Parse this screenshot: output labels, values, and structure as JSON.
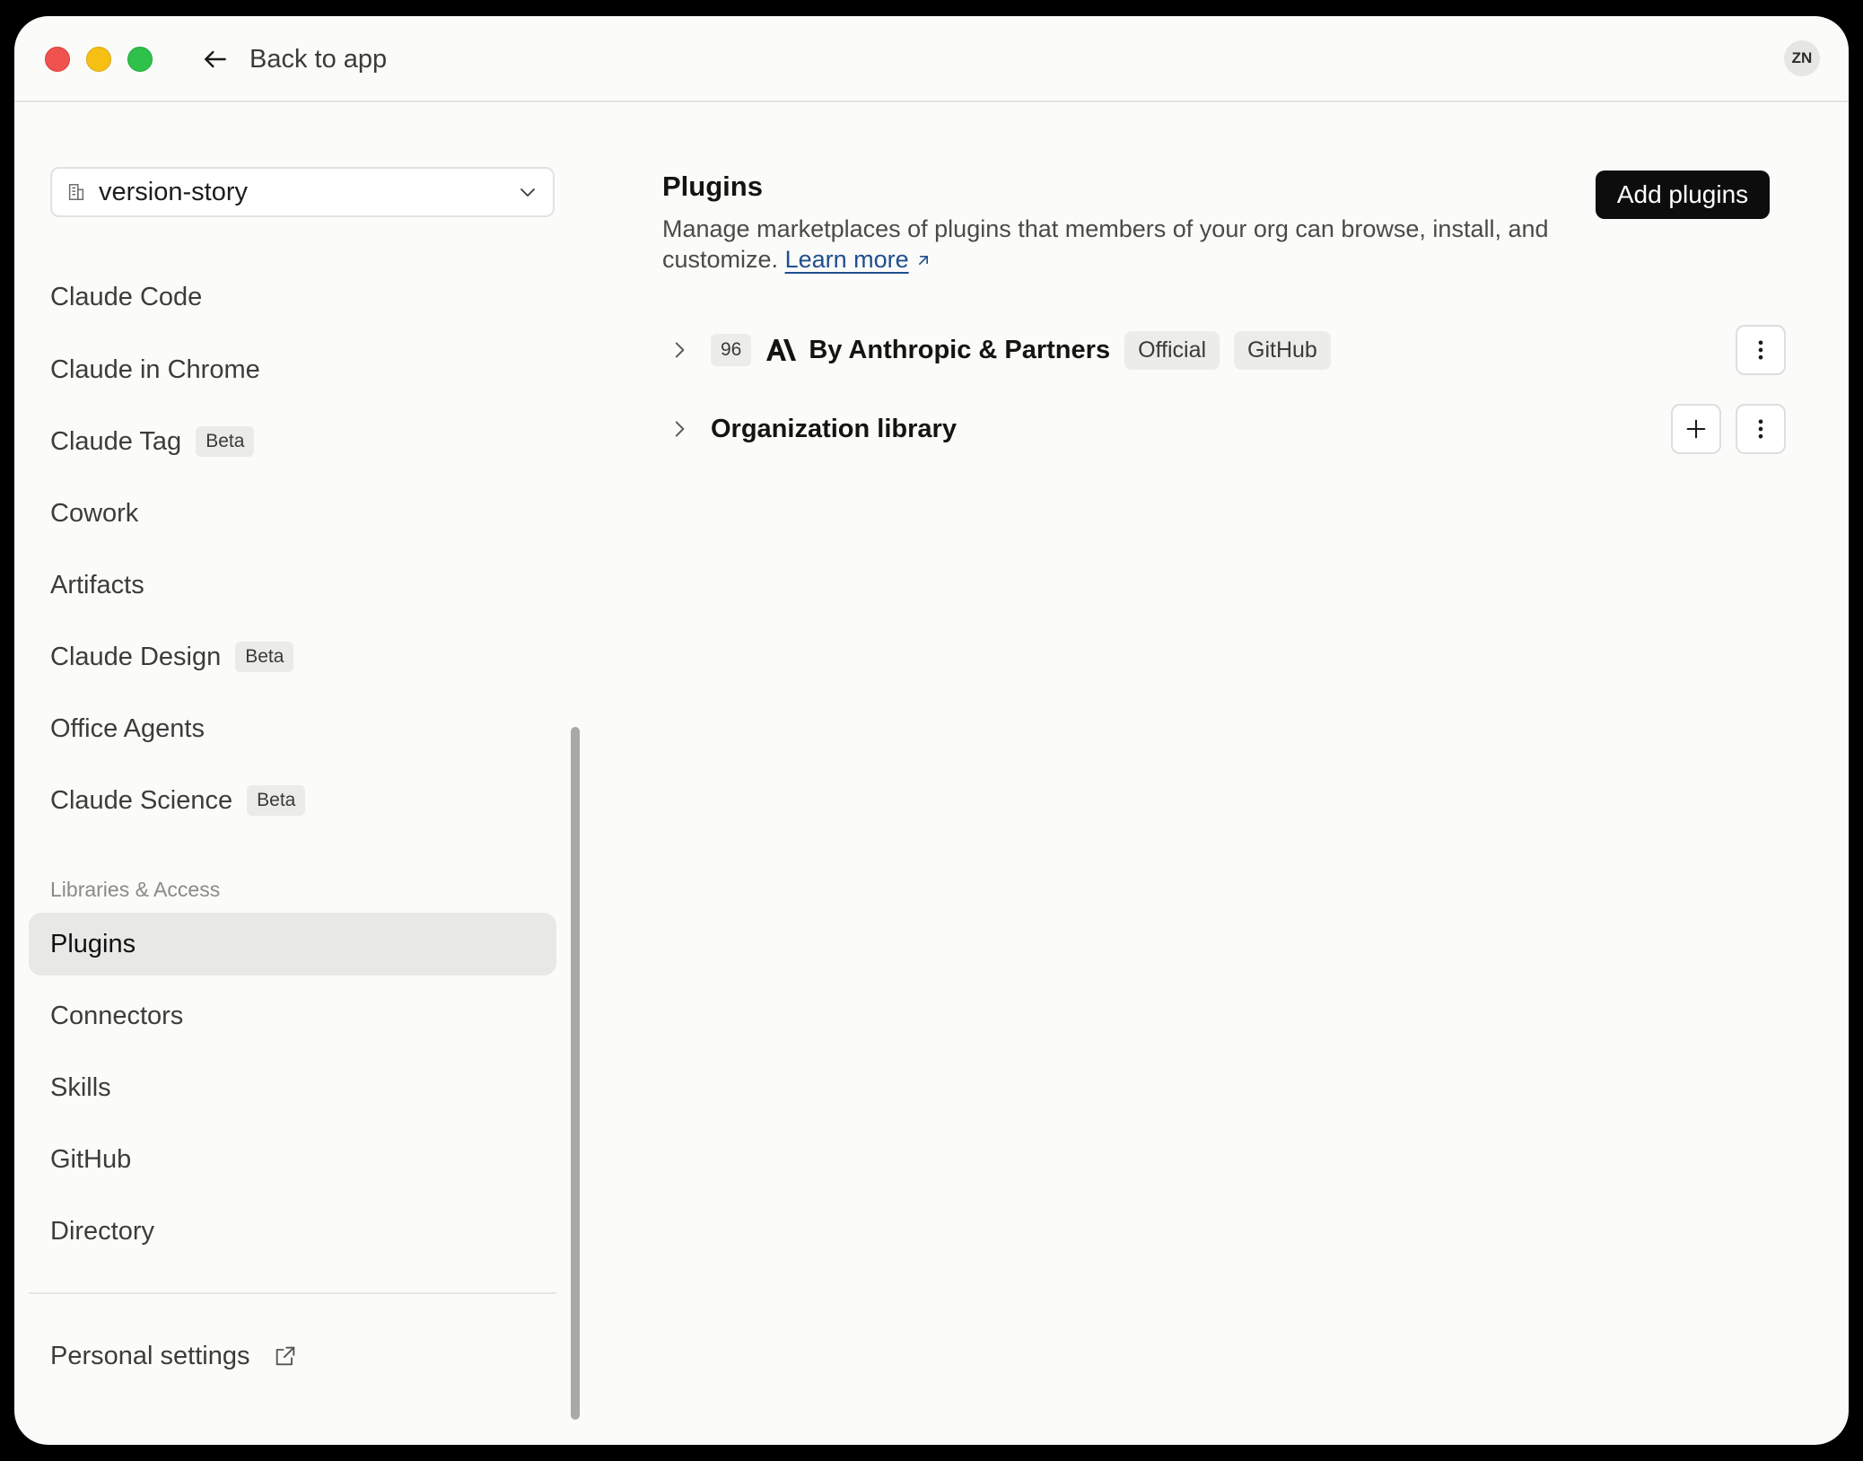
{
  "titlebar": {
    "back_label": "Back to app",
    "avatar_initials": "ZN"
  },
  "sidebar": {
    "org": {
      "name": "version-story"
    },
    "items": [
      {
        "label": "Claude Code",
        "badge": ""
      },
      {
        "label": "Claude in Chrome",
        "badge": ""
      },
      {
        "label": "Claude Tag",
        "badge": "Beta"
      },
      {
        "label": "Cowork",
        "badge": ""
      },
      {
        "label": "Artifacts",
        "badge": ""
      },
      {
        "label": "Claude Design",
        "badge": "Beta"
      },
      {
        "label": "Office Agents",
        "badge": ""
      },
      {
        "label": "Claude Science",
        "badge": "Beta"
      }
    ],
    "section_label": "Libraries & Access",
    "library_items": [
      {
        "label": "Plugins",
        "active": true
      },
      {
        "label": "Connectors"
      },
      {
        "label": "Skills"
      },
      {
        "label": "GitHub"
      },
      {
        "label": "Directory"
      }
    ],
    "personal_settings": "Personal settings"
  },
  "main": {
    "title": "Plugins",
    "description": "Manage marketplaces of plugins that members of your org can browse, install, and customize.",
    "learn_more": "Learn more",
    "add_button": "Add plugins",
    "marketplaces": [
      {
        "count": "96",
        "name": "By Anthropic & Partners",
        "tags": [
          "Official",
          "GitHub"
        ]
      },
      {
        "name": "Organization library"
      }
    ]
  },
  "colors": {
    "accent_button": "#0d0d0d",
    "link": "#1f4f8f",
    "active_nav": "#e8e8e6"
  }
}
